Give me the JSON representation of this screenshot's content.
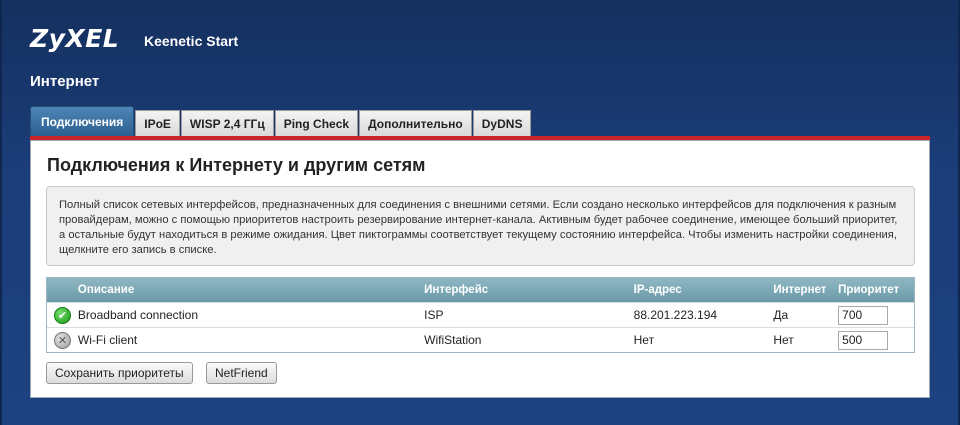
{
  "brand": {
    "logo": "ZyXEL",
    "model": "Keenetic Start"
  },
  "page": {
    "section_title": "Интернет"
  },
  "tabs": [
    {
      "label": "Подключения",
      "active": true
    },
    {
      "label": "IPoE",
      "active": false
    },
    {
      "label": "WISP 2,4 ГГц",
      "active": false
    },
    {
      "label": "Ping Check",
      "active": false
    },
    {
      "label": "Дополнительно",
      "active": false
    },
    {
      "label": "DyDNS",
      "active": false
    }
  ],
  "panel": {
    "title": "Подключения к Интернету и другим сетям",
    "info": "Полный список сетевых интерфейсов, предназначенных для соединения с внешними сетями. Если создано несколько интерфейсов для подключения к разным провайдерам, можно с помощью приоритетов настроить резервирование интернет-канала. Активным будет рабочее соединение, имеющее больший приоритет, а остальные будут находиться в режиме ожидания. Цвет пиктограммы соответствует текущему состоянию интерфейса. Чтобы изменить настройки соединения, щелкните его запись в списке."
  },
  "table": {
    "headers": {
      "description": "Описание",
      "interface": "Интерфейс",
      "ip": "IP-адрес",
      "internet": "Интернет",
      "priority": "Приоритет"
    },
    "rows": [
      {
        "status_icon": "check-circle-icon",
        "status_color": "#2aa825",
        "description": "Broadband connection",
        "interface": "ISP",
        "ip": "88.201.223.194",
        "internet": "Да",
        "priority": "700"
      },
      {
        "status_icon": "x-circle-icon",
        "status_color": "#a0a0a0",
        "description": "Wi-Fi client",
        "interface": "WifiStation",
        "ip": "Нет",
        "internet": "Нет",
        "priority": "500"
      }
    ]
  },
  "buttons": {
    "save_priorities": "Сохранить приоритеты",
    "netfriend": "NetFriend"
  },
  "colors": {
    "background": "#1b3d78",
    "active_tab": "#2f6595",
    "accent_line": "#c8242a",
    "table_header": "#7aa8b5"
  }
}
